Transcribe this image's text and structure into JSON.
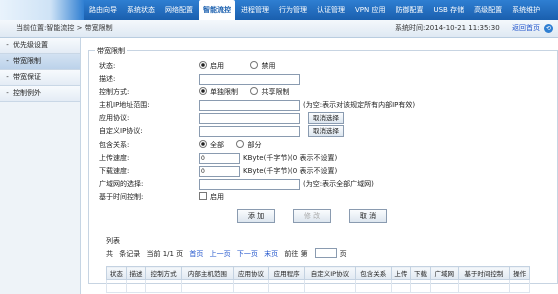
{
  "topnav": {
    "items": [
      "路由向导",
      "系统状态",
      "网络配置",
      "智能流控",
      "进程管理",
      "行为管理",
      "认证管理",
      "VPN 应用",
      "防御配置",
      "USB 存储",
      "高级配置",
      "系统维护"
    ],
    "active_index": 3
  },
  "subbar": {
    "breadcrumb": "当前位置:智能流控 > 带宽限制",
    "system_time": "系统时间:2014-10-21 11:35:30",
    "back_label": "返回首页"
  },
  "sidebar": {
    "items": [
      {
        "label": "优先级设置",
        "marker": "-"
      },
      {
        "label": "带宽限制",
        "marker": "-"
      },
      {
        "label": "带宽保证",
        "marker": "-"
      },
      {
        "label": "控制例外",
        "marker": "-"
      }
    ],
    "active_index": 1
  },
  "form": {
    "panel_title": "带宽限制",
    "status": {
      "label": "状态:",
      "opt_on": "启用",
      "opt_off": "禁用",
      "selected": "启用"
    },
    "description": {
      "label": "描述:",
      "value": ""
    },
    "control_mode": {
      "label": "控制方式:",
      "opt_a": "单独限制",
      "opt_b": "共享限制",
      "selected": "单独限制"
    },
    "host_ip_range": {
      "label": "主机IP地址范围:",
      "value": "",
      "hint": "(为空:表示对该规定所有内部IP有效)"
    },
    "app_protocol": {
      "label": "应用协议:",
      "value": "",
      "button": "取消选择"
    },
    "custom_ip_protocol": {
      "label": "自定义IP协议:",
      "value": "",
      "button": "取消选择"
    },
    "include_relation": {
      "label": "包含关系:",
      "opt_a": "全部",
      "opt_b": "部分",
      "selected": "全部"
    },
    "upload_speed": {
      "label": "上传速度:",
      "value": "0",
      "unit": "KByte(千字节)(0 表示不设置)"
    },
    "download_speed": {
      "label": "下载速度:",
      "value": "0",
      "unit": "KByte(千字节)(0 表示不设置)"
    },
    "wan_select": {
      "label": "广域网的选择:",
      "value": "",
      "hint": "(为空:表示全部广域网)"
    },
    "time_control": {
      "label": "基于时间控制:",
      "opt": "启用",
      "checked": false
    },
    "buttons": {
      "add": "添 加",
      "modify": "修 改",
      "cancel": "取 消"
    }
  },
  "list": {
    "title": "列表",
    "pager": {
      "total_prefix": "共",
      "records_suffix": "条记录",
      "current": "当前 1/1 页",
      "first": "首页",
      "prev": "上一页",
      "next": "下一页",
      "last": "末页",
      "goto_prefix": "前往 第",
      "goto_suffix": "页"
    },
    "columns": [
      "状态",
      "描述",
      "控制方式",
      "内部主机范围",
      "应用协议",
      "应用程序",
      "自定义IP协议",
      "包含关系",
      "上传",
      "下载",
      "广域网",
      "基于时间控制",
      "操作"
    ]
  }
}
